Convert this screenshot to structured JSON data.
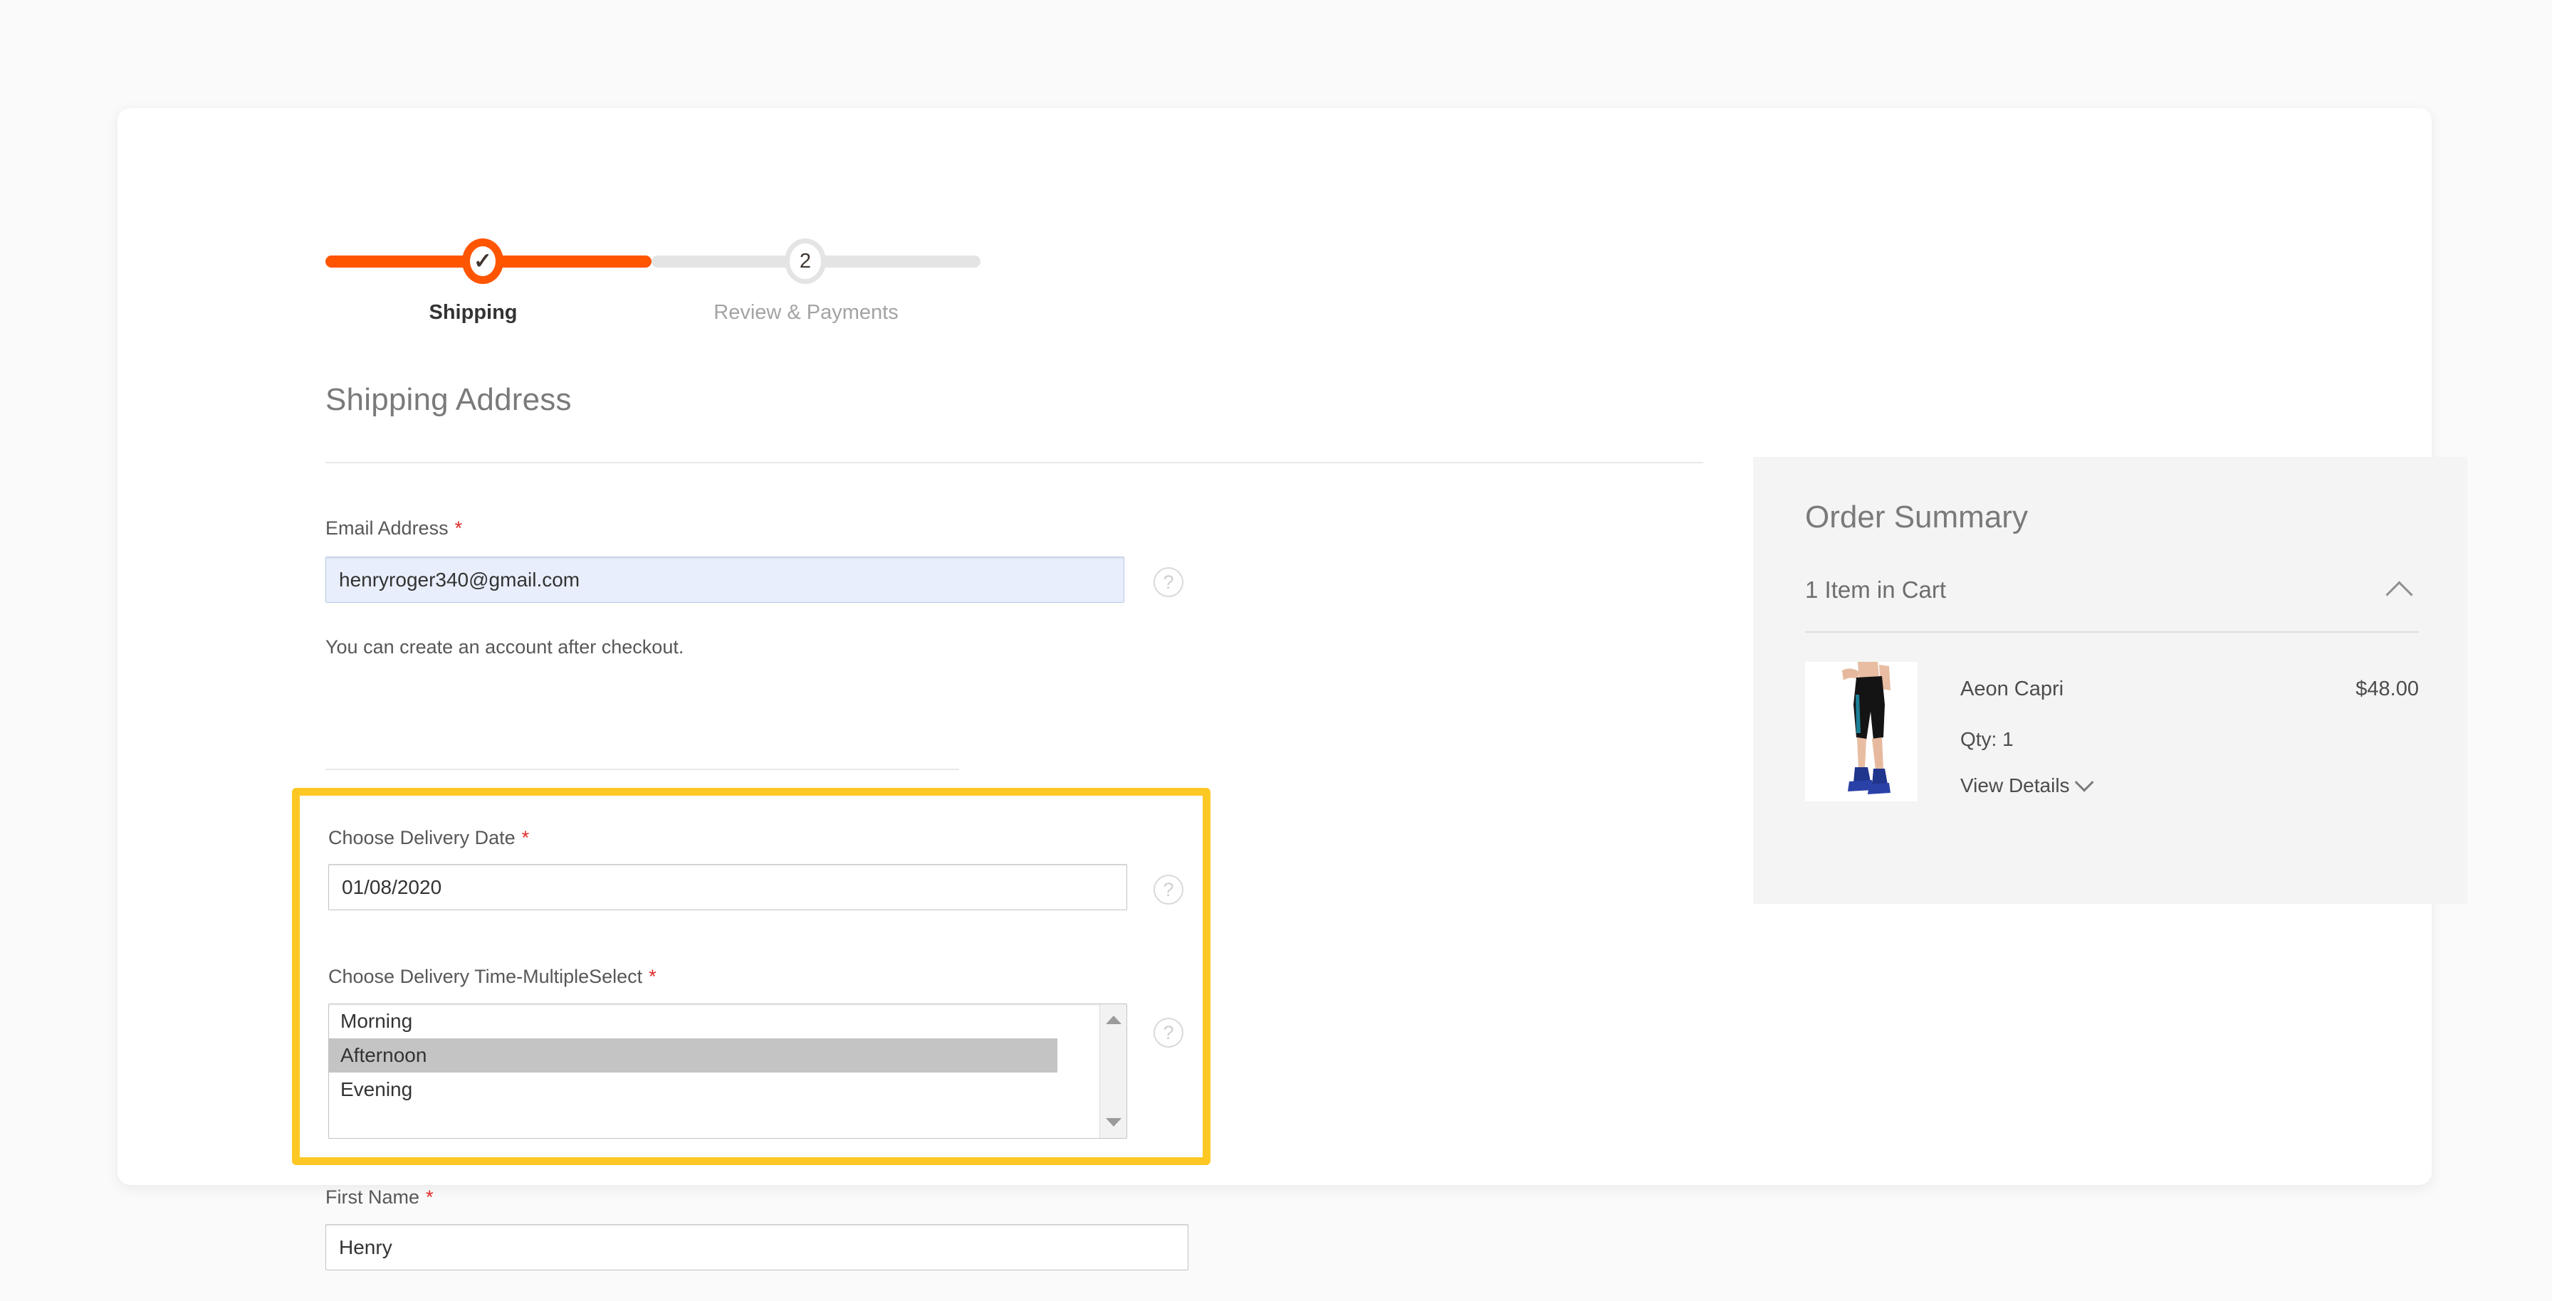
{
  "progress": {
    "steps": [
      {
        "label": "Shipping",
        "marker": "✓",
        "state": "complete"
      },
      {
        "label": "Review & Payments",
        "marker": "2",
        "state": "upcoming"
      }
    ]
  },
  "shipping": {
    "section_title": "Shipping Address",
    "email": {
      "label": "Email Address",
      "required_mark": "*",
      "value": "henryroger340@gmail.com",
      "placeholder": "",
      "note": "You can create an account after checkout.",
      "help_icon": "question-mark-icon"
    },
    "delivery_date": {
      "label": "Choose Delivery Date",
      "required_mark": "*",
      "value": "01/08/2020",
      "placeholder": "",
      "help_icon": "question-mark-icon"
    },
    "delivery_time": {
      "label": "Choose Delivery Time-MultipleSelect",
      "required_mark": "*",
      "options": [
        "Morning",
        "Afternoon",
        "Evening"
      ],
      "selected": [
        "Afternoon"
      ],
      "help_icon": "question-mark-icon"
    },
    "first_name": {
      "label": "First Name",
      "required_mark": "*",
      "value": "Henry",
      "placeholder": ""
    }
  },
  "order_summary": {
    "title": "Order Summary",
    "cart_count_label": "1 Item in Cart",
    "collapse_icon": "chevron-up-icon",
    "items": [
      {
        "name": "Aeon Capri",
        "price": "$48.00",
        "qty_label": "Qty: 1",
        "view_details_label": "View Details",
        "view_details_icon": "chevron-down-icon"
      }
    ]
  },
  "colors": {
    "accent_orange": "#ff5501",
    "highlight_yellow": "#fdc824",
    "required_red": "#e02b27",
    "panel_gray": "#f4f4f4",
    "selected_option_gray": "#c4c4c4",
    "focus_field_blue": "#e8eefb"
  }
}
